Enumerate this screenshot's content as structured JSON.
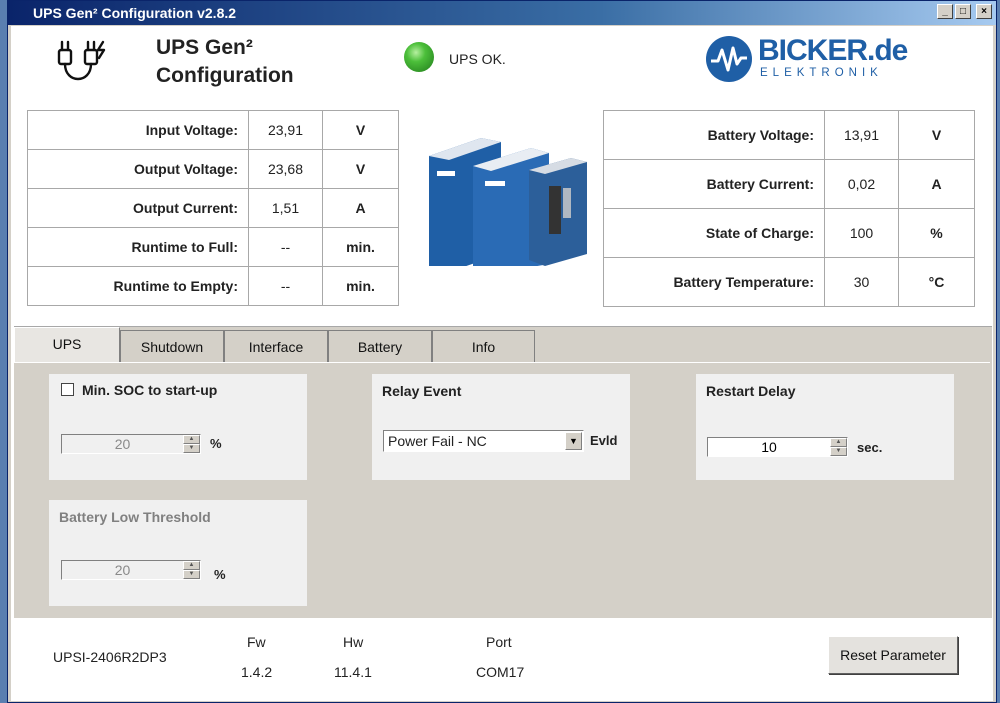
{
  "window": {
    "title": "UPS Gen² Configuration v2.8.2"
  },
  "header": {
    "title_line1": "UPS Gen²",
    "title_line2": "Configuration",
    "status_text": "UPS OK.",
    "logo_name": "BICKER.de",
    "logo_sub": "ELEKTRONIK"
  },
  "left_table": [
    {
      "label": "Input Voltage:",
      "value": "23,91",
      "unit": "V"
    },
    {
      "label": "Output Voltage:",
      "value": "23,68",
      "unit": "V"
    },
    {
      "label": "Output Current:",
      "value": "1,51",
      "unit": "A"
    },
    {
      "label": "Runtime to Full:",
      "value": "--",
      "unit": "min."
    },
    {
      "label": "Runtime to Empty:",
      "value": "--",
      "unit": "min."
    }
  ],
  "right_table": [
    {
      "label": "Battery Voltage:",
      "value": "13,91",
      "unit": "V"
    },
    {
      "label": "Battery Current:",
      "value": "0,02",
      "unit": "A"
    },
    {
      "label": "State of Charge:",
      "value": "100",
      "unit": "%"
    },
    {
      "label": "Battery Temperature:",
      "value": "30",
      "unit": "°C"
    }
  ],
  "tabs": [
    {
      "label": "UPS"
    },
    {
      "label": "Shutdown"
    },
    {
      "label": "Interface"
    },
    {
      "label": "Battery"
    },
    {
      "label": "Info"
    }
  ],
  "ups_tab": {
    "min_soc": {
      "label": "Min. SOC to start-up",
      "checked": false,
      "value": "20",
      "unit": "%"
    },
    "battery_low": {
      "label": "Battery Low Threshold",
      "value": "20",
      "unit": "%"
    },
    "relay_event": {
      "label": "Relay Event",
      "selected": "Power Fail - NC",
      "suffix": "Evld"
    },
    "restart_delay": {
      "label": "Restart Delay",
      "value": "10",
      "unit": "sec."
    }
  },
  "footer": {
    "model": "UPSI-2406R2DP3",
    "fw_label": "Fw",
    "fw_value": "1.4.2",
    "hw_label": "Hw",
    "hw_value": "11.4.1",
    "port_label": "Port",
    "port_value": "COM17",
    "reset_label": "Reset Parameter"
  },
  "colors": {
    "brand": "#1f5fa6",
    "status_ok": "#4cbf3a",
    "panel": "#d4d0c8"
  }
}
